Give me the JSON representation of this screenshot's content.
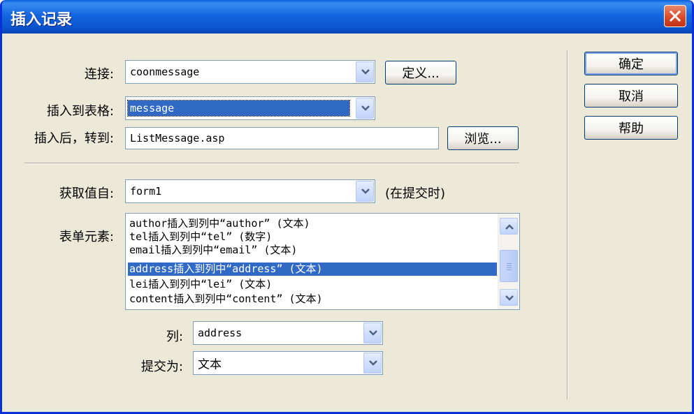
{
  "dialog": {
    "title": "插入记录"
  },
  "connection": {
    "label": "连接:",
    "value": "coonmessage",
    "define_label": "定义..."
  },
  "insert_table": {
    "label": "插入到表格:",
    "value": "message"
  },
  "after_insert": {
    "label": "插入后，转到:",
    "value": "ListMessage.asp",
    "browse_label": "浏览..."
  },
  "get_values": {
    "label": "获取值自:",
    "value": "form1",
    "note": "(在提交时)"
  },
  "form_elements": {
    "label": "表单元素:",
    "items": [
      {
        "text": "author插入到列中“author” (文本)",
        "selected": false
      },
      {
        "text": "tel插入到列中“tel” (数字)",
        "selected": false
      },
      {
        "text": "email插入到列中“email” (文本)",
        "selected": false
      },
      {
        "text": "address插入到列中“address” (文本)",
        "selected": true
      },
      {
        "text": "lei插入到列中“lei” (文本)",
        "selected": false
      },
      {
        "text": "content插入到列中“content” (文本)",
        "selected": false
      }
    ]
  },
  "column": {
    "label": "列:",
    "value": "address"
  },
  "submit_as": {
    "label": "提交为:",
    "value": "文本"
  },
  "buttons": {
    "ok": "确定",
    "cancel": "取消",
    "help": "帮助"
  },
  "colors": {
    "titlebar": "#0a5fd8",
    "selection": "#316ac5",
    "dialog_bg": "#ece9d8",
    "close": "#d74b2a"
  }
}
